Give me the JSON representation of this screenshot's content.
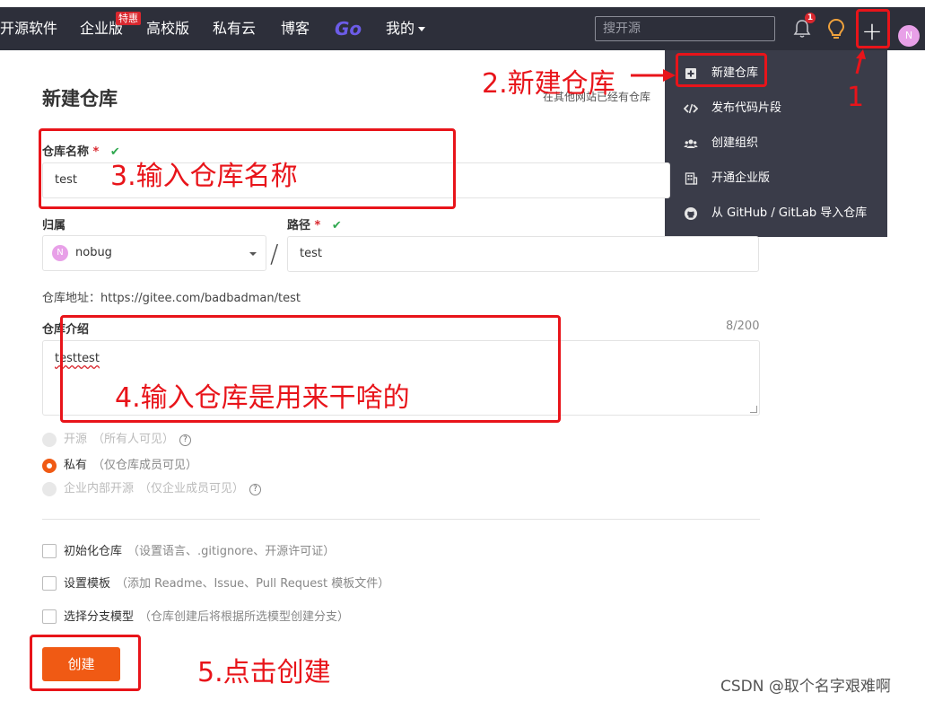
{
  "topbar": {
    "nav": [
      "开源软件",
      "企业版",
      "高校版",
      "私有云",
      "博客",
      "Go",
      "我的"
    ],
    "enterprise_badge": "特惠",
    "search_placeholder": "搜开源",
    "notification_count": "1",
    "avatar_initial": "N"
  },
  "dropdown": {
    "items": [
      "新建仓库",
      "发布代码片段",
      "创建组织",
      "开通企业版",
      "从 GitHub / GitLab 导入仓库"
    ]
  },
  "form": {
    "title": "新建仓库",
    "hint": "在其他网站已经有仓库",
    "repo_name_label": "仓库名称",
    "required_mark": "*",
    "check_mark": "✔",
    "repo_name_value": "test",
    "owner_label": "归属",
    "owner_initial": "N",
    "owner_value": "nobug",
    "path_label": "路径",
    "path_separator": "/",
    "path_value": "test",
    "address": "仓库地址：https://gitee.com/badbadman/test",
    "intro_label": "仓库介绍",
    "intro_counter": "8/200",
    "intro_value": "testtest",
    "visibility": [
      {
        "label": "开源",
        "sub": "（所有人可见）",
        "help": "?",
        "selected": false
      },
      {
        "label": "私有",
        "sub": "（仅仓库成员可见）",
        "selected": true
      },
      {
        "label": "企业内部开源",
        "sub": "（仅企业成员可见）",
        "help": "?",
        "selected": false
      }
    ],
    "options": [
      {
        "label": "初始化仓库",
        "sub": "（设置语言、.gitignore、开源许可证）"
      },
      {
        "label": "设置模板",
        "sub": "（添加 Readme、Issue、Pull Request 模板文件）"
      },
      {
        "label": "选择分支模型",
        "sub": "（仓库创建后将根据所选模型创建分支）"
      }
    ],
    "create_button": "创建"
  },
  "annotations": {
    "step1": "1",
    "step2": "2.新建仓库",
    "step3": "3.输入仓库名称",
    "step4": "4.输入仓库是用来干啥的",
    "step5": "5.点击创建",
    "color": "#e8141a"
  },
  "watermark": "CSDN @取个名字艰难啊",
  "colors": {
    "topbar": "#2d2f3a",
    "dropdown": "#3a3c49",
    "accent": "#f05a14",
    "valid": "#2fa84f"
  }
}
